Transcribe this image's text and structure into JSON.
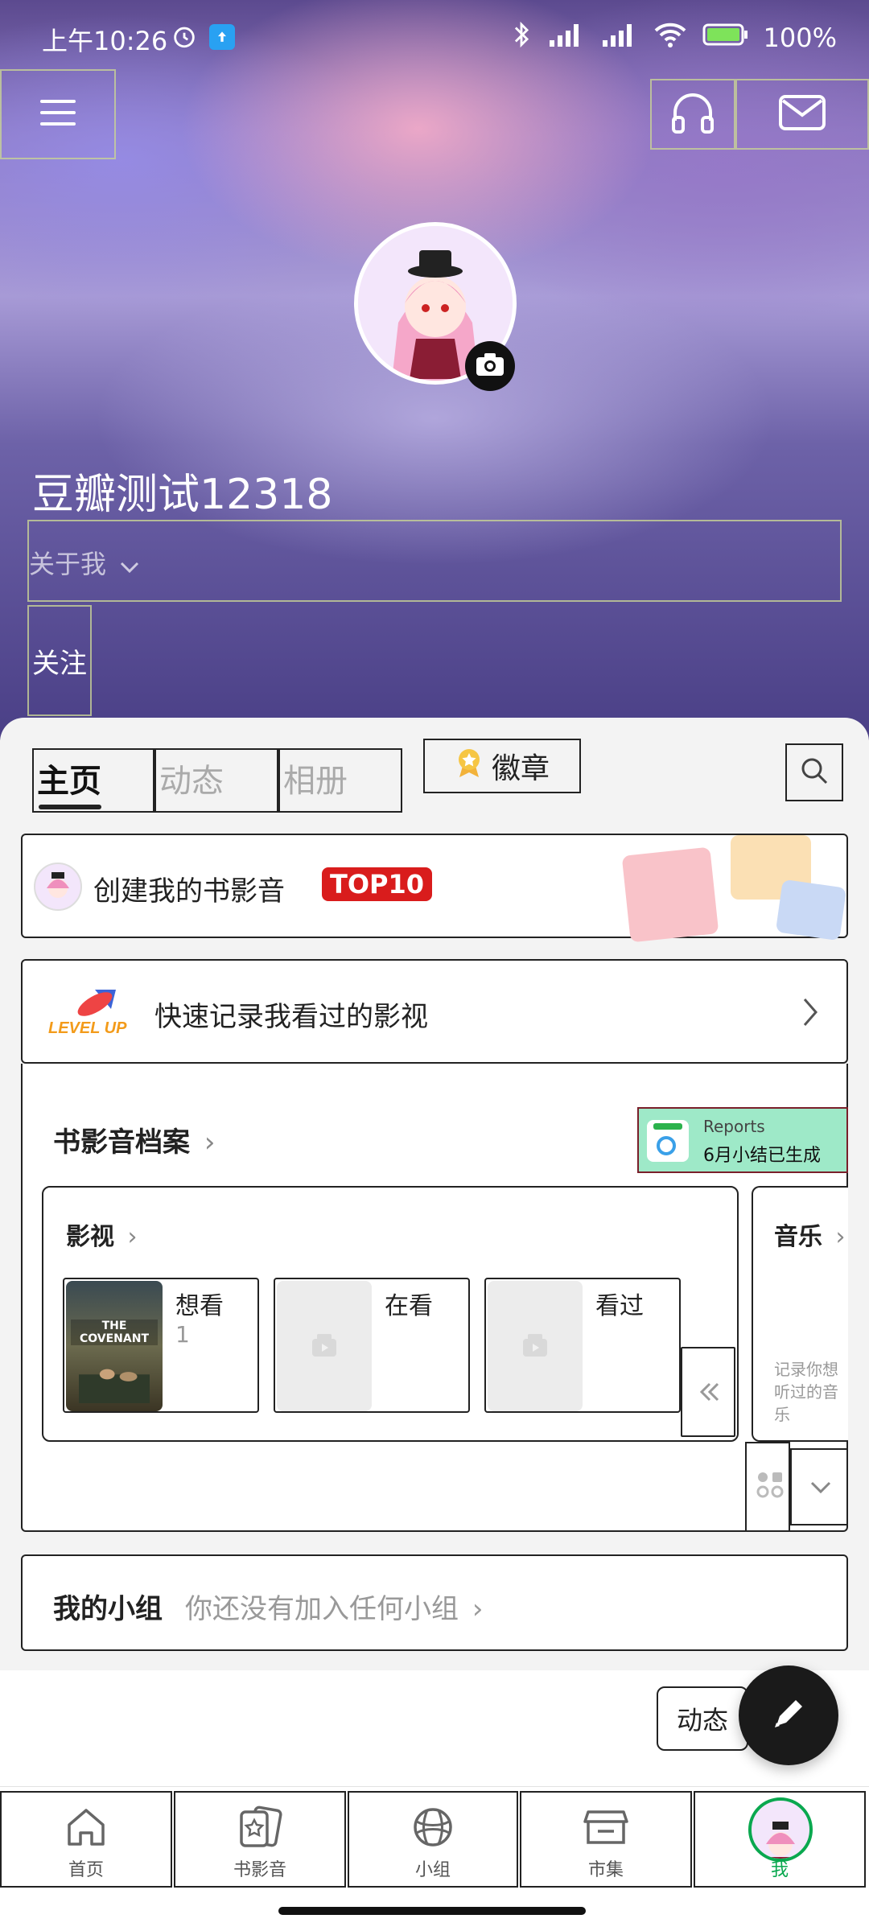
{
  "status_bar": {
    "time": "上午10:26",
    "battery": "100%"
  },
  "header": {
    "name": "豆瓣测试12318",
    "about": "关于我",
    "follow": "关注"
  },
  "tabs": [
    {
      "label": "主页"
    },
    {
      "label": "动态"
    },
    {
      "label": "相册"
    }
  ],
  "badge_label": "徽章",
  "create_card": {
    "text": "创建我的书影音",
    "top_label": "TOP10"
  },
  "record_card": {
    "text": "快速记录我看过的影视",
    "level_label": "LEVEL UP!"
  },
  "archive": {
    "title": "书影音档案",
    "reports": {
      "label": "Reports",
      "subtitle": "6月小结已生成"
    },
    "movie": {
      "title": "影视",
      "items": [
        {
          "label": "想看",
          "count": "1",
          "poster_text": "THE COVENANT"
        },
        {
          "label": "在看",
          "count": ""
        },
        {
          "label": "看过",
          "count": ""
        }
      ]
    },
    "music": {
      "title": "音乐",
      "hint": "记录你想听过的音乐"
    }
  },
  "groups": {
    "title": "我的小组",
    "subtitle": "你还没有加入任何小组"
  },
  "floating": {
    "dongtai": "动态"
  },
  "nav": [
    {
      "label": "首页",
      "icon": "home-icon"
    },
    {
      "label": "书影音",
      "icon": "book-movie-music-icon"
    },
    {
      "label": "小组",
      "icon": "group-icon"
    },
    {
      "label": "市集",
      "icon": "market-icon"
    },
    {
      "label": "我",
      "icon": "avatar"
    }
  ],
  "colors": {
    "accent": "#0aa84f",
    "top_badge": "#d91c1c",
    "reports_bg": "#9ee9c8"
  }
}
